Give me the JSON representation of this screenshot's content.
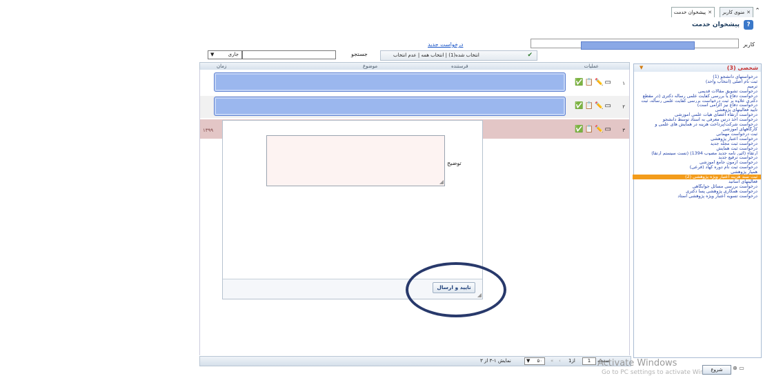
{
  "tabs": [
    {
      "label": "منوی کاربر"
    },
    {
      "label": "پیشخوان خدمت"
    }
  ],
  "page_title": "پیشخوان خدمت",
  "user_label": "کاربر",
  "left_panel": {
    "title": "شخصی (3)",
    "items": [
      "درخواستهای دانشجو (1)",
      "ثبت نام اصلی (انتخاب واحد)",
      "ترمیم",
      "درخواست تشویق مقالات قدیمی",
      "درخواست دفاع یا بررسی کفایت علمی رساله دکتری (در مقطع",
      "دکتری علاوه بر ثبت درخواست بررسی کفایت علمی رساله، ثبت",
      "درخواست دفاع نیز الزامی است)",
      "تایید فعالیتهای پژوهشی",
      "درخواست ارتقاء اعضای هیات علمی آموزشی",
      "درخواست اخذ درس معرفی به استاد توسط دانشجو",
      "درخواست شرکت/پرداخت هزینه در همایش های علمی و",
      "کارگاههای آموزشی",
      "ثبت درخواست مهمانی",
      "درخواست اعتبار پژوهشی",
      "درخواست ثبت مجله جدید",
      "درخواست ثبت همایش",
      "ارتقاء (آئین نامه جدید مصوب 1394) (تست سیستم ارتقا)",
      "درخواست ترفیع جدید",
      "درخواست آزمون جامع آموزشی",
      "درخواست ثبت نام دوره کهاد (فرعی)",
      "همیار پژوهشی",
      "ثبت سند هزینه اعتبار ویژه پژوهشی (2)",
      "فعالیتهای اساتید",
      "درخواست بررسی مسائل جوابگاهی",
      "درخواست همکاری پژوهشی پسا دکتری",
      "درخواست تسویه اعتبار ویژه پژوهشی استاد"
    ]
  },
  "toolbar": {
    "new_request": "درخواست جدید",
    "search_label": "جستجو",
    "status_value": "جاری",
    "selection_text": "انتخاب شده(1) | انتخاب همه | عدم انتخاب"
  },
  "grid": {
    "headers": {
      "ops": "عملیات",
      "sender": "فرستنده",
      "subject": "موضوع",
      "time": "زمان"
    },
    "rows": [
      {
        "num": "۱",
        "date": ""
      },
      {
        "num": "۲",
        "date": ""
      },
      {
        "num": "۳",
        "date": "۱۳۹۹"
      }
    ]
  },
  "modal": {
    "desc_label": "توضیح",
    "submit_label": "تایید و ارسال"
  },
  "pager": {
    "page_label": "صفحه",
    "page_value": "1",
    "of_text": "از1",
    "page_size": "۵۰",
    "display_text": "نمایش ۱-۳ از ۳"
  },
  "watermark": {
    "line1": "Activate Windows",
    "line2": "Go to PC settings to activate Windows."
  },
  "start_label": "شروع",
  "colors": {
    "selected_item": "#f39c1b",
    "mask": "#9bb7ee",
    "highlight_row": "#e3c6c6",
    "circle": "#28396b"
  }
}
